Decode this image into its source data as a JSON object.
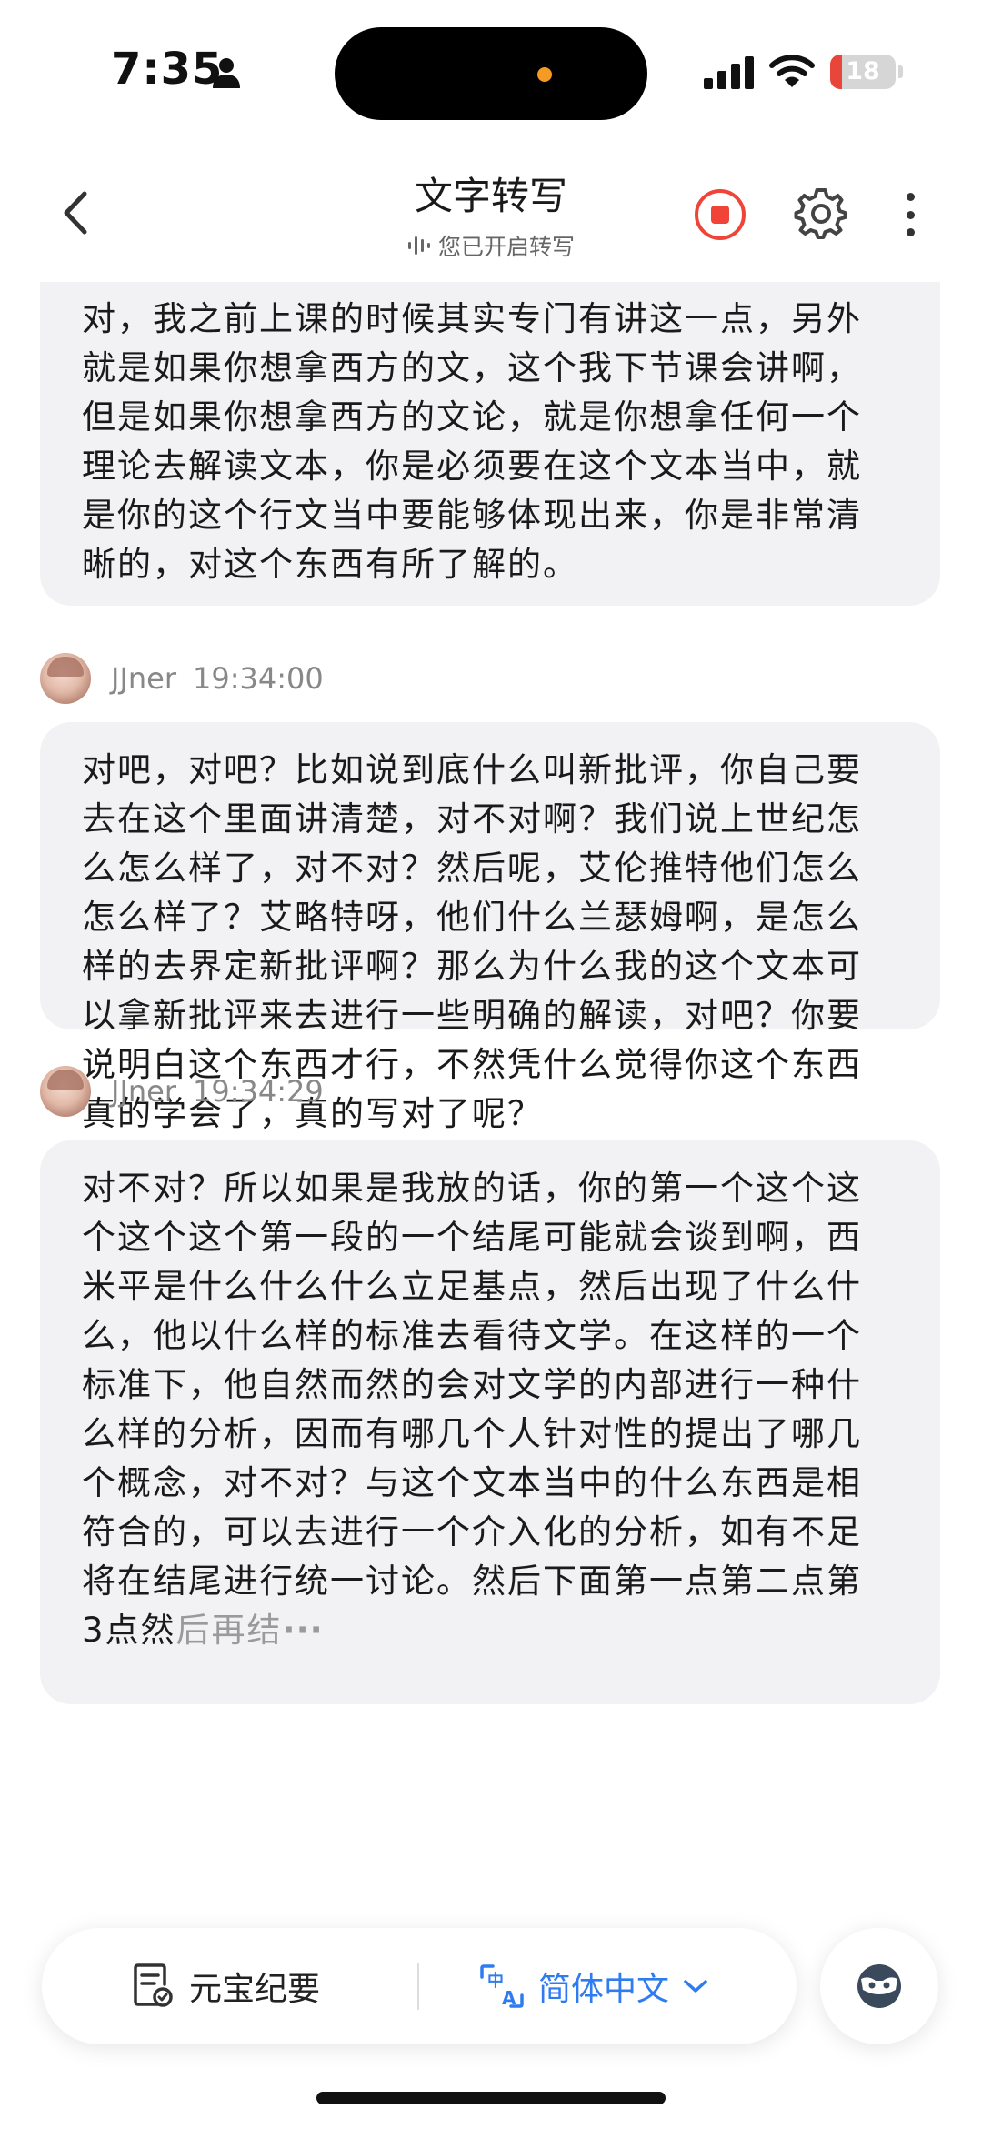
{
  "status_bar": {
    "time": "7:35",
    "battery_level": "18",
    "battery_fraction": 0.18,
    "accent_dot_color": "#f59a23",
    "battery_color": "#e8463b"
  },
  "header": {
    "title": "文字转写",
    "subtitle": "您已开启转写",
    "icons": [
      "chevron-left-icon",
      "audio-wave-icon",
      "record-stop-icon",
      "gear-icon",
      "more-vertical-icon"
    ],
    "record_color": "#f04438"
  },
  "transcript": {
    "segments": [
      {
        "text": "对，我之前上课的时候其实专门有讲这一点，另外就是如果你想拿西方的文，这个我下节课会讲啊，但是如果你想拿西方的文论，就是你想拿任何一个理论去解读文本，你是必须要在这个文本当中，就是你的这个行文当中要能够体现出来，你是非常清晰的，对这个东西有所了解的。"
      },
      {
        "speaker": "JJner",
        "time": "19:34:00",
        "text": "对吧，对吧？比如说到底什么叫新批评，你自己要去在这个里面讲清楚，对不对啊？我们说上世纪怎么怎么样了，对不对？然后呢，艾伦推特他们怎么怎么样了？艾略特呀，他们什么兰瑟姆啊，是怎么样的去界定新批评啊？那么为什么我的这个文本可以拿新批评来去进行一些明确的解读，对吧？你要说明白这个东西才行，不然凭什么觉得你这个东西真的学会了，真的写对了呢？"
      },
      {
        "speaker": "JJner",
        "time": "19:34:29",
        "text": "对不对？所以如果是我放的话，你的第一个这个这个这个这个第一段的一个结尾可能就会谈到啊，西米平是什么什么什么立足基点，然后出现了什么什么，他以什么样的标准去看待文学。在这样的一个标准下，他自然而然的会对文学的内部进行一种什么样的分析，因而有哪几个人针对性的提出了哪几个概念，对不对？与这个文本当中的什么东西是相符合的，可以去进行一个介入化的分析，如有不足将在结尾进行统一讨论。然后下面第一点第二点第3点然",
        "text_tail": "后再结",
        "tail_ellipsis": "···"
      }
    ]
  },
  "toolbar": {
    "summary_label": "元宝纪要",
    "language_label": "简体中文",
    "icons": [
      "document-summary-icon",
      "translate-icon",
      "chevron-down-icon",
      "assistant-avatar-icon"
    ],
    "language_color": "#2f7bf0"
  }
}
